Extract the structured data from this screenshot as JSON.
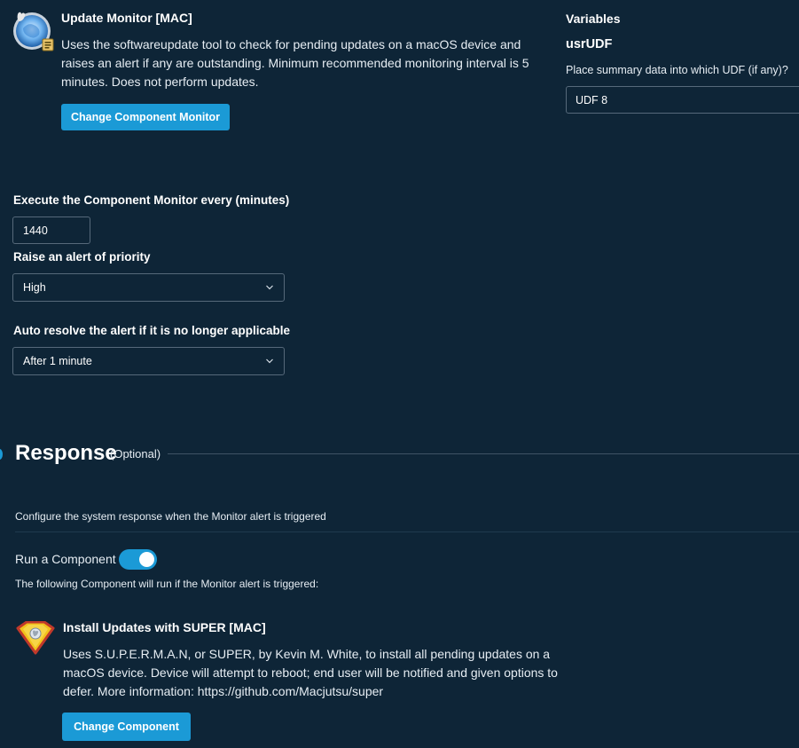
{
  "monitor": {
    "title": "Update Monitor [MAC]",
    "description": "Uses the softwareupdate tool to check for pending updates on a macOS device and raises an alert if any are outstanding. Minimum recommended monitoring interval is 5 minutes. Does not perform updates.",
    "change_button": "Change Component Monitor",
    "icon": "mac-update-globe-icon"
  },
  "variables": {
    "heading": "Variables",
    "name": "usrUDF",
    "description": "Place summary data into which UDF (if any)?",
    "value": "UDF 8"
  },
  "settings": {
    "interval_label": "Execute the Component Monitor every (minutes)",
    "interval_value": "1440",
    "priority_label": "Raise an alert of priority",
    "priority_value": "High",
    "autoresolve_label": "Auto resolve the alert if it is no longer applicable",
    "autoresolve_value": "After 1 minute"
  },
  "response": {
    "title": "Response",
    "optional": "(Optional)",
    "description": "Configure the system response when the Monitor alert is triggered",
    "run_label": "Run a Component",
    "run_enabled": true,
    "following_text": "The following Component will run if the Monitor alert is triggered:"
  },
  "component": {
    "title": "Install Updates with SUPER [MAC]",
    "description": "Uses S.U.P.E.R.M.A.N, or SUPER, by Kevin M. White, to install all pending updates on a macOS device. Device will attempt to reboot; end user will be notified and given options to defer. More information: https://github.com/Macjutsu/super",
    "change_button": "Change Component",
    "icon": "superman-shield-icon"
  },
  "colors": {
    "background": "#0e2537",
    "accent": "#1b9ad6",
    "field_border": "#56697a"
  }
}
